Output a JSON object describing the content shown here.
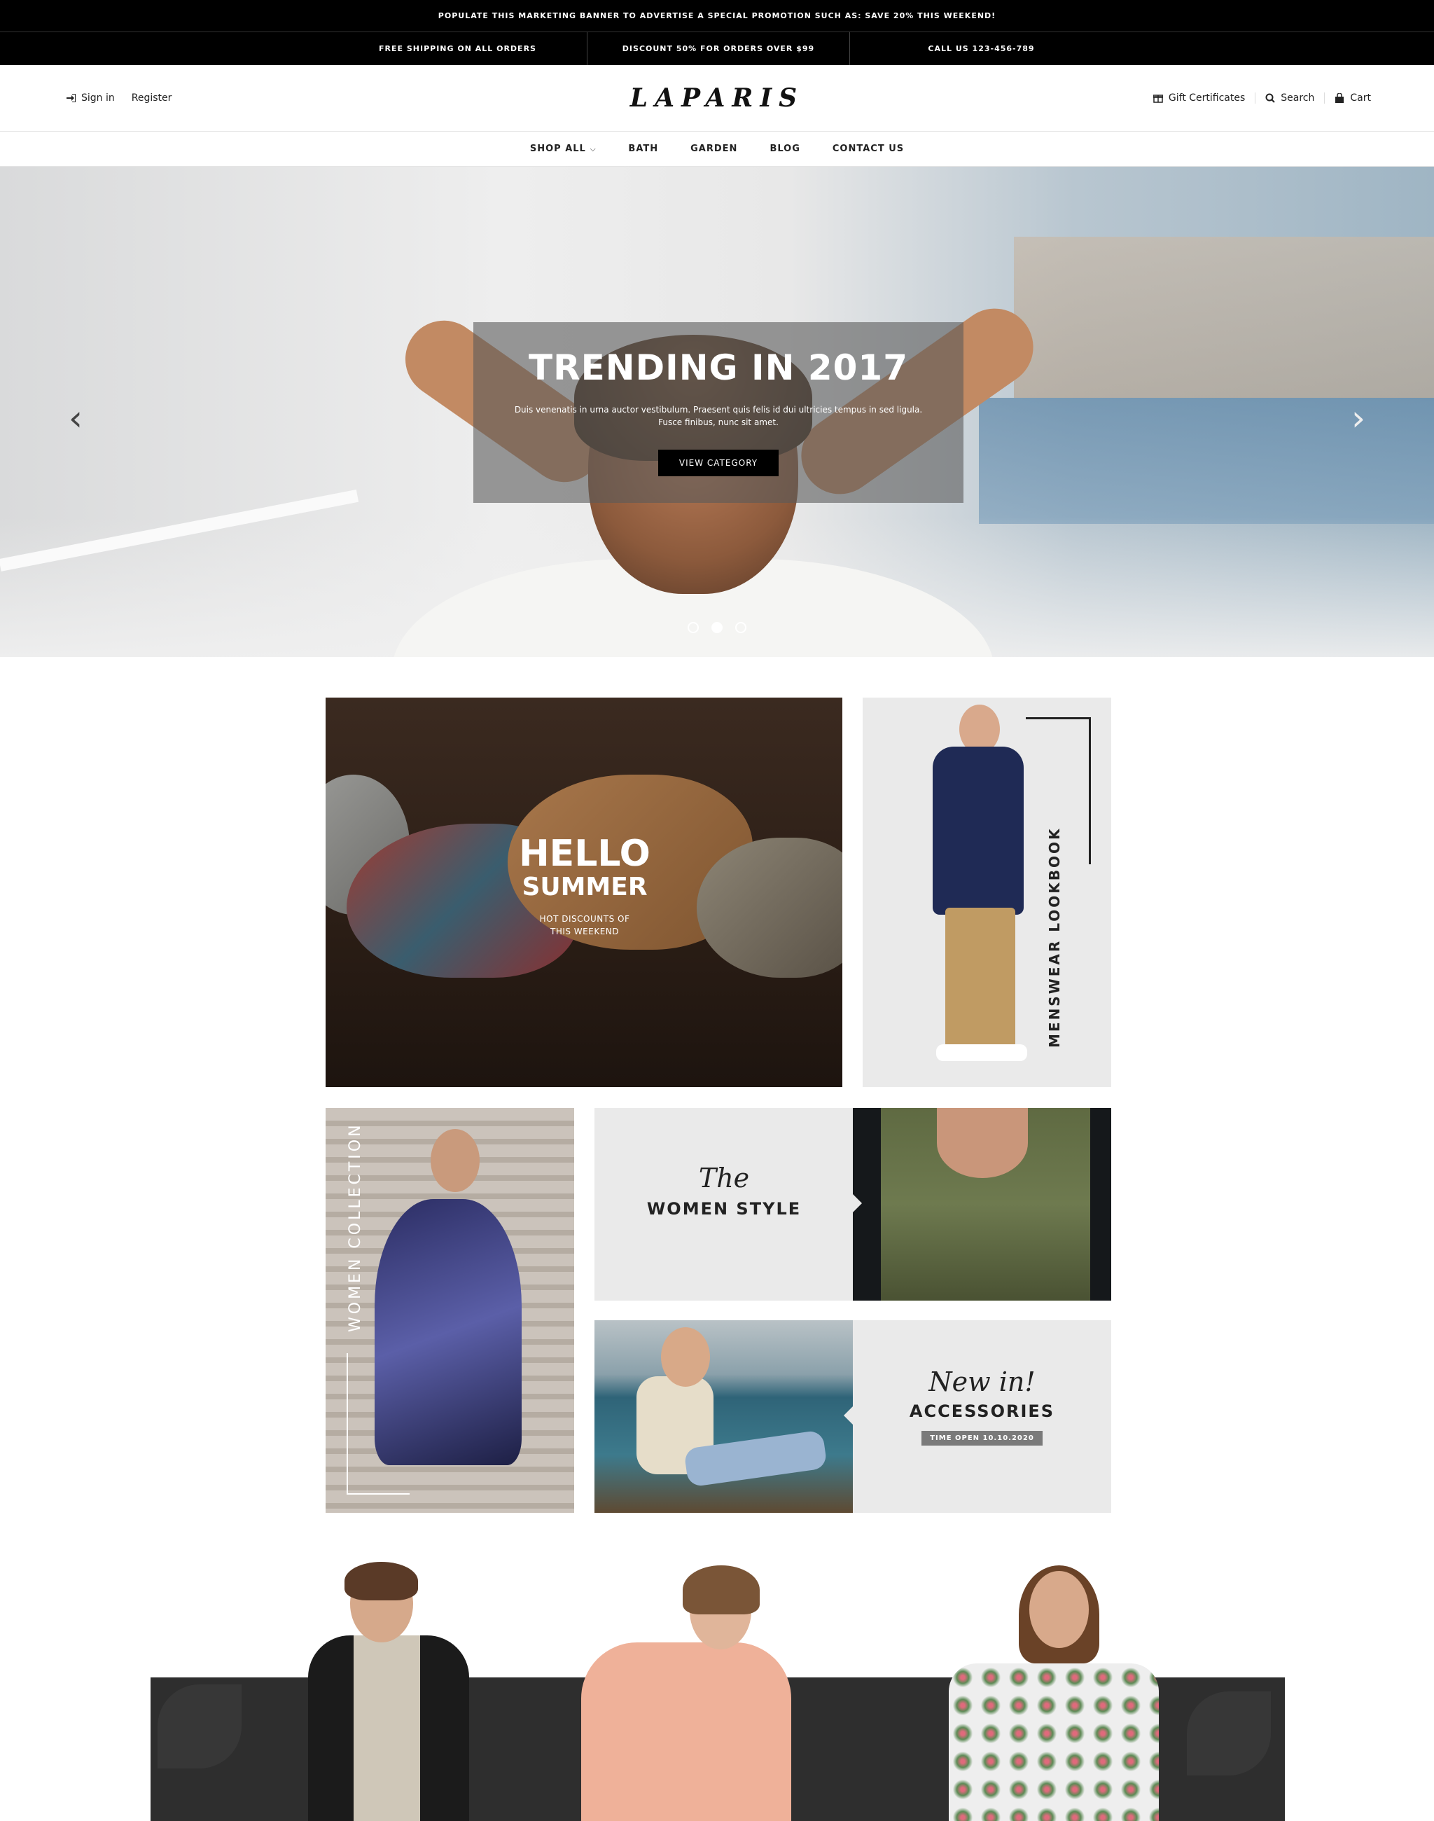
{
  "promo": {
    "text": "POPULATE THIS MARKETING BANNER TO ADVERTISE A SPECIAL PROMOTION SUCH AS: SAVE 20% THIS WEEKEND!"
  },
  "info_bar": {
    "items": [
      "FREE SHIPPING ON ALL ORDERS",
      "DISCOUNT 50% FOR ORDERS OVER $99",
      "CALL US 123-456-789"
    ]
  },
  "header": {
    "sign_in": "Sign in",
    "register": "Register",
    "logo": "LAPARIS",
    "gift": "Gift Certificates",
    "search": "Search",
    "cart": "Cart"
  },
  "nav": {
    "items": [
      "SHOP ALL",
      "BATH",
      "GARDEN",
      "BLOG",
      "CONTACT US"
    ]
  },
  "hero": {
    "title": "TRENDING IN 2017",
    "text": "Duis venenatis in urna auctor vestibulum. Praesent quis felis id dui ultricies tempus in sed ligula. Fusce finibus, nunc sit amet.",
    "button": "VIEW CATEGORY",
    "prev_arrow": "‹",
    "next_arrow": "›",
    "slide_index": 2,
    "slide_count": 3
  },
  "banners": {
    "summer": {
      "line1": "HELLO",
      "line2": "SUMMER",
      "line3": "HOT DISCOUNTS OF",
      "line4": "THIS WEEKEND"
    },
    "menswear": {
      "label": "MENSWEAR LOOKBOOK"
    },
    "women_collection": {
      "label": "WOMEN COLLECTION"
    },
    "women_style": {
      "script": "The",
      "caps": "WOMEN STYLE"
    },
    "accessories": {
      "script": "New in!",
      "caps": "ACCESSORIES",
      "tag": "TIME OPEN 10.10.2020"
    }
  },
  "colors": {
    "bar": "#000000",
    "panel": "#2e2e2e",
    "tile": "#eaeaea"
  }
}
